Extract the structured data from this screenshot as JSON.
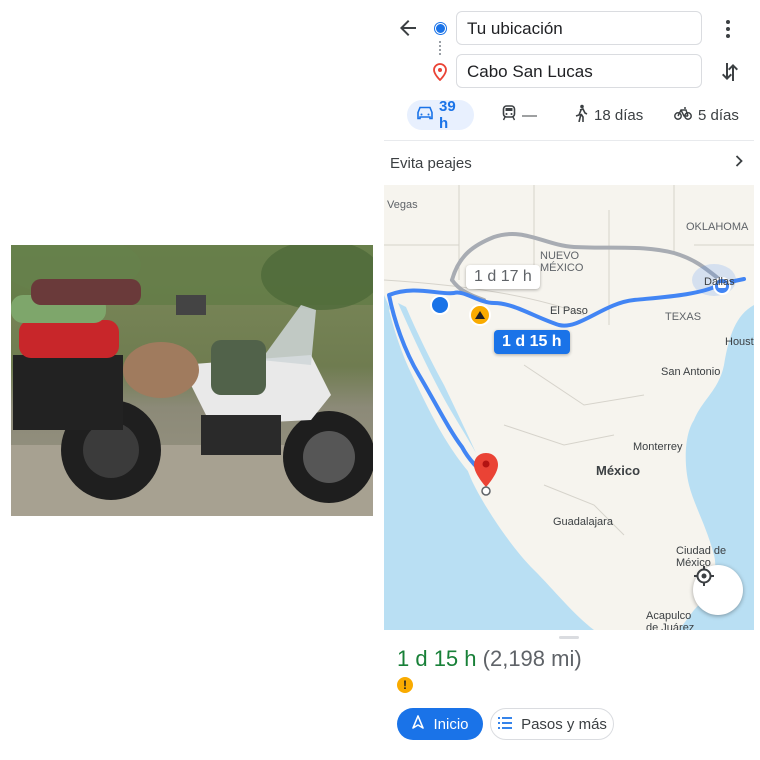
{
  "search": {
    "origin_value": "Tu ubicación",
    "destination_value": "Cabo San Lucas"
  },
  "modes": [
    {
      "icon": "car-icon",
      "label": "39 h",
      "selected": true
    },
    {
      "icon": "transit-icon",
      "label": "—",
      "selected": false
    },
    {
      "icon": "walk-icon",
      "label": "18 días",
      "selected": false
    },
    {
      "icon": "bike-icon",
      "label": "5 días",
      "selected": false
    }
  ],
  "options": {
    "tolls_label": "Evita peajes"
  },
  "map": {
    "labels": {
      "vegas": "Vegas",
      "nuevo_mexico": "NUEVO\nMÉXICO",
      "oklahoma": "OKLAHOMA",
      "el_paso": "El Paso",
      "texas": "TEXAS",
      "dallas": "Dallas",
      "houston": "Houst",
      "san_antonio": "San Antonio",
      "monterrey": "Monterrey",
      "mexico": "México",
      "guadalajara": "Guadalajara",
      "ciudad_de_mexico": "Ciudad de\nMéxico",
      "acapulco": "Acapulco\nde Juárez"
    },
    "route_alt_label": "1 d 17 h",
    "route_main_label": "1 d 15 h",
    "colors": {
      "route_main": "#4285f4",
      "route_alt": "#a8acb3",
      "water": "#b9dff3",
      "land": "#f6f4ee",
      "destination_pin": "#ea4335"
    }
  },
  "summary": {
    "duration": "1 d 15 h",
    "distance": "(2,198 mi)",
    "warning_icon": "warning-icon"
  },
  "actions": {
    "start_label": "Inicio",
    "steps_label": "Pasos y más"
  }
}
